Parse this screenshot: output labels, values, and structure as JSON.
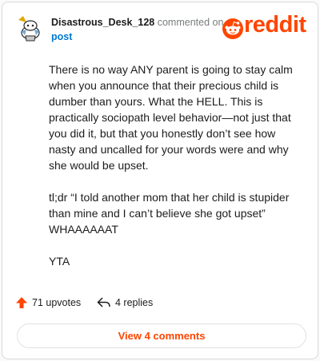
{
  "comment": {
    "username": "Disastrous_Desk_128",
    "action": "commented on",
    "post_link": "post",
    "paragraphs": [
      "There is no way ANY parent is going to stay calm when you announce that their precious child is dumber than yours. What the HELL. This is practically sociopath level behavior—not just that you did it, but that you honestly don’t see how nasty and uncalled for your words were and why she would be upset.",
      "tl;dr “I told another mom that her child is stupider than mine and I can’t believe she got upset” WHAAAAAAT",
      "YTA"
    ]
  },
  "brand": {
    "name": "reddit",
    "color": "#ff4500"
  },
  "actions": {
    "upvotes": "71 upvotes",
    "replies": "4 replies",
    "upvote_icon": "upvote-arrow-icon",
    "reply_icon": "reply-arrow-icon"
  },
  "view_comments": "View 4 comments"
}
